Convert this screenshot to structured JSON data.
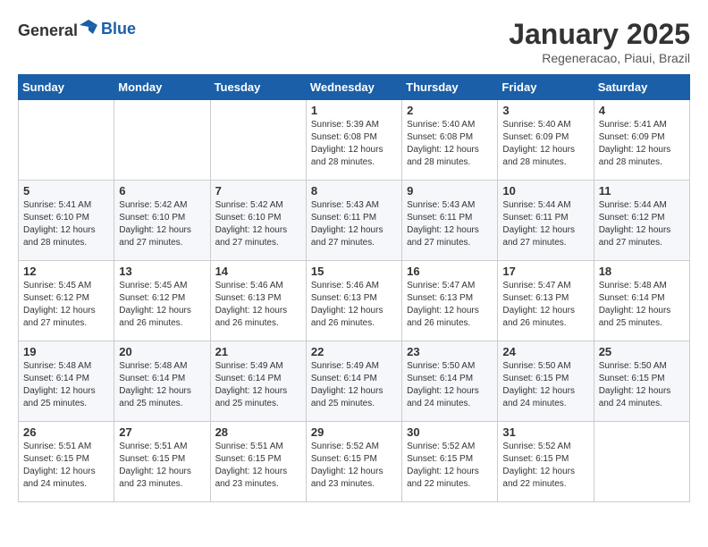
{
  "logo": {
    "general": "General",
    "blue": "Blue"
  },
  "header": {
    "month_year": "January 2025",
    "location": "Regeneracao, Piaui, Brazil"
  },
  "days_of_week": [
    "Sunday",
    "Monday",
    "Tuesday",
    "Wednesday",
    "Thursday",
    "Friday",
    "Saturday"
  ],
  "weeks": [
    [
      {
        "day": "",
        "info": ""
      },
      {
        "day": "",
        "info": ""
      },
      {
        "day": "",
        "info": ""
      },
      {
        "day": "1",
        "info": "Sunrise: 5:39 AM\nSunset: 6:08 PM\nDaylight: 12 hours\nand 28 minutes."
      },
      {
        "day": "2",
        "info": "Sunrise: 5:40 AM\nSunset: 6:08 PM\nDaylight: 12 hours\nand 28 minutes."
      },
      {
        "day": "3",
        "info": "Sunrise: 5:40 AM\nSunset: 6:09 PM\nDaylight: 12 hours\nand 28 minutes."
      },
      {
        "day": "4",
        "info": "Sunrise: 5:41 AM\nSunset: 6:09 PM\nDaylight: 12 hours\nand 28 minutes."
      }
    ],
    [
      {
        "day": "5",
        "info": "Sunrise: 5:41 AM\nSunset: 6:10 PM\nDaylight: 12 hours\nand 28 minutes."
      },
      {
        "day": "6",
        "info": "Sunrise: 5:42 AM\nSunset: 6:10 PM\nDaylight: 12 hours\nand 27 minutes."
      },
      {
        "day": "7",
        "info": "Sunrise: 5:42 AM\nSunset: 6:10 PM\nDaylight: 12 hours\nand 27 minutes."
      },
      {
        "day": "8",
        "info": "Sunrise: 5:43 AM\nSunset: 6:11 PM\nDaylight: 12 hours\nand 27 minutes."
      },
      {
        "day": "9",
        "info": "Sunrise: 5:43 AM\nSunset: 6:11 PM\nDaylight: 12 hours\nand 27 minutes."
      },
      {
        "day": "10",
        "info": "Sunrise: 5:44 AM\nSunset: 6:11 PM\nDaylight: 12 hours\nand 27 minutes."
      },
      {
        "day": "11",
        "info": "Sunrise: 5:44 AM\nSunset: 6:12 PM\nDaylight: 12 hours\nand 27 minutes."
      }
    ],
    [
      {
        "day": "12",
        "info": "Sunrise: 5:45 AM\nSunset: 6:12 PM\nDaylight: 12 hours\nand 27 minutes."
      },
      {
        "day": "13",
        "info": "Sunrise: 5:45 AM\nSunset: 6:12 PM\nDaylight: 12 hours\nand 26 minutes."
      },
      {
        "day": "14",
        "info": "Sunrise: 5:46 AM\nSunset: 6:13 PM\nDaylight: 12 hours\nand 26 minutes."
      },
      {
        "day": "15",
        "info": "Sunrise: 5:46 AM\nSunset: 6:13 PM\nDaylight: 12 hours\nand 26 minutes."
      },
      {
        "day": "16",
        "info": "Sunrise: 5:47 AM\nSunset: 6:13 PM\nDaylight: 12 hours\nand 26 minutes."
      },
      {
        "day": "17",
        "info": "Sunrise: 5:47 AM\nSunset: 6:13 PM\nDaylight: 12 hours\nand 26 minutes."
      },
      {
        "day": "18",
        "info": "Sunrise: 5:48 AM\nSunset: 6:14 PM\nDaylight: 12 hours\nand 25 minutes."
      }
    ],
    [
      {
        "day": "19",
        "info": "Sunrise: 5:48 AM\nSunset: 6:14 PM\nDaylight: 12 hours\nand 25 minutes."
      },
      {
        "day": "20",
        "info": "Sunrise: 5:48 AM\nSunset: 6:14 PM\nDaylight: 12 hours\nand 25 minutes."
      },
      {
        "day": "21",
        "info": "Sunrise: 5:49 AM\nSunset: 6:14 PM\nDaylight: 12 hours\nand 25 minutes."
      },
      {
        "day": "22",
        "info": "Sunrise: 5:49 AM\nSunset: 6:14 PM\nDaylight: 12 hours\nand 25 minutes."
      },
      {
        "day": "23",
        "info": "Sunrise: 5:50 AM\nSunset: 6:14 PM\nDaylight: 12 hours\nand 24 minutes."
      },
      {
        "day": "24",
        "info": "Sunrise: 5:50 AM\nSunset: 6:15 PM\nDaylight: 12 hours\nand 24 minutes."
      },
      {
        "day": "25",
        "info": "Sunrise: 5:50 AM\nSunset: 6:15 PM\nDaylight: 12 hours\nand 24 minutes."
      }
    ],
    [
      {
        "day": "26",
        "info": "Sunrise: 5:51 AM\nSunset: 6:15 PM\nDaylight: 12 hours\nand 24 minutes."
      },
      {
        "day": "27",
        "info": "Sunrise: 5:51 AM\nSunset: 6:15 PM\nDaylight: 12 hours\nand 23 minutes."
      },
      {
        "day": "28",
        "info": "Sunrise: 5:51 AM\nSunset: 6:15 PM\nDaylight: 12 hours\nand 23 minutes."
      },
      {
        "day": "29",
        "info": "Sunrise: 5:52 AM\nSunset: 6:15 PM\nDaylight: 12 hours\nand 23 minutes."
      },
      {
        "day": "30",
        "info": "Sunrise: 5:52 AM\nSunset: 6:15 PM\nDaylight: 12 hours\nand 22 minutes."
      },
      {
        "day": "31",
        "info": "Sunrise: 5:52 AM\nSunset: 6:15 PM\nDaylight: 12 hours\nand 22 minutes."
      },
      {
        "day": "",
        "info": ""
      }
    ]
  ]
}
